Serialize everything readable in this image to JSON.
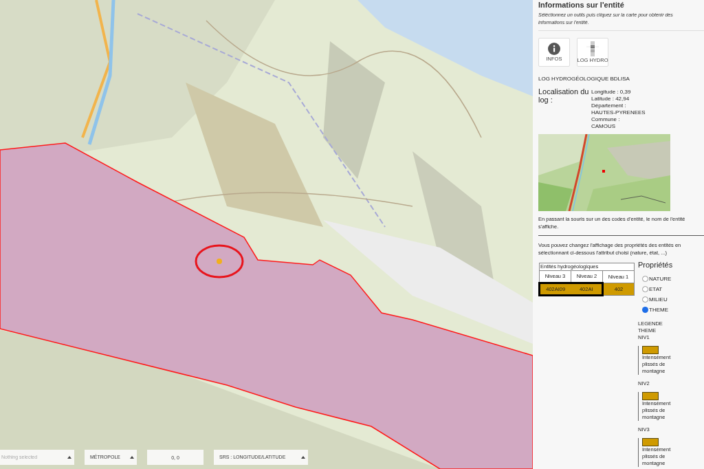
{
  "bottom_bar": [
    {
      "kind": "select",
      "placeholder": "Nothing selected"
    },
    {
      "kind": "select",
      "value": "MÉTROPOLE"
    },
    {
      "kind": "field",
      "value": "0, 0"
    },
    {
      "kind": "select",
      "value": "SRS : LONGITUDE/LATITUDE"
    }
  ],
  "panel": {
    "title": "Informations sur l'entité",
    "instructions": "Séléctionnez un outils puis cliquez sur la carte pour obtenir des informations sur l'entité.",
    "tools": [
      {
        "kind": "info",
        "label": "INFOS"
      },
      {
        "kind": "log",
        "label": "LOG HYDRO"
      }
    ],
    "log_title": "LOG HYDROGÉOLOGIQUE BDLISA",
    "localisation": {
      "label": "Localisation du log :",
      "lines": [
        "Longitude : 0,39",
        "Latitude : 42,94",
        "Département :",
        "HAUTES-PYRENEES",
        "Commune :",
        "CAMOUS"
      ]
    },
    "hover_note": "En passant la souris sur un des codes d'entité, le nom de l'entité s'affiche.",
    "properties_note": "Vous pouvez changez l'affichage des propriétés des entités en sélectionnant ci-dessous l'attribut choisi (nature, état, ...)",
    "table": {
      "caption": "Entités hydrogéologiques",
      "columns": [
        "Niveau 3",
        "Niveau 2",
        "Niveau 1"
      ],
      "cells": [
        {
          "text": "402AI09",
          "selected": true
        },
        {
          "text": "402AI",
          "selected": true
        },
        {
          "text": "402",
          "selected": false
        }
      ]
    },
    "properties": {
      "title": "Propriétés",
      "options": [
        {
          "label": "NATURE",
          "selected": false
        },
        {
          "label": "ETAT",
          "selected": false
        },
        {
          "label": "MILIEU",
          "selected": false
        },
        {
          "label": "THEME",
          "selected": true
        }
      ]
    },
    "legend": {
      "heading": [
        "LEGENDE",
        "THEME"
      ],
      "groups": [
        {
          "level": "NIV1",
          "color": "#cf9a00",
          "text": "Intensément plissés de montagne"
        },
        {
          "level": "NIV2",
          "color": "#cf9a00",
          "text": "Intensément plissés de montagne"
        },
        {
          "level": "NIV3",
          "color": "#cf9a00",
          "text": "Intensément plissés de montagne"
        }
      ]
    }
  }
}
